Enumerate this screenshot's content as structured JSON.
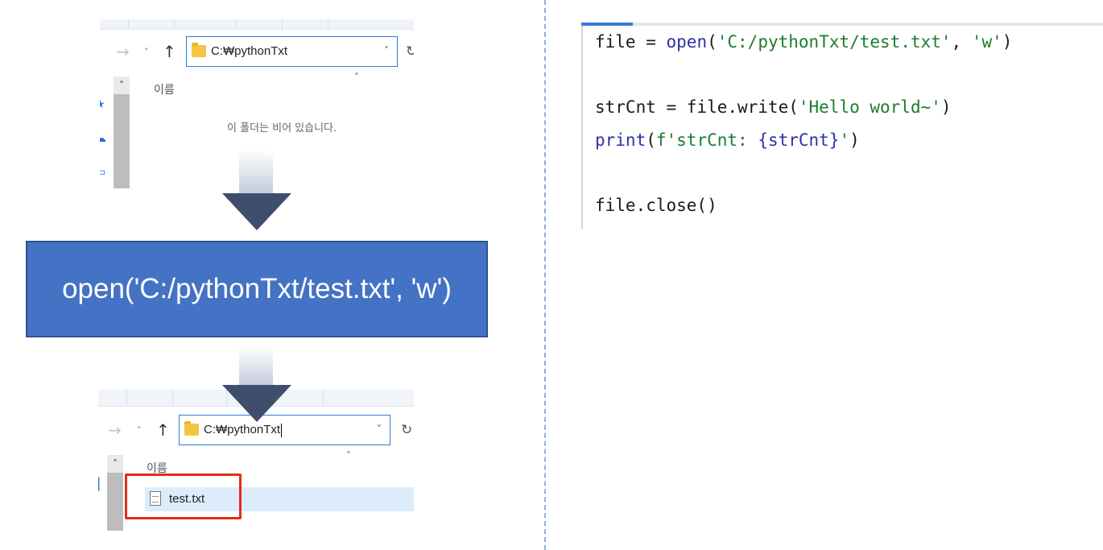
{
  "explorer_top": {
    "address_path": "C:₩pythonTxt",
    "column_name": "이름",
    "empty_message": "이 폴더는 비어 있습니다."
  },
  "explorer_bottom": {
    "address_path": "C:₩pythonTxt",
    "column_name": "이름",
    "file_name": "test.txt"
  },
  "open_box_text": "open('C:/pythonTxt/test.txt', 'w')",
  "icons": {
    "back": "→",
    "down": "˅",
    "up": "↑",
    "chevron": "˅",
    "refresh": "↻",
    "sort": "˄",
    "caret": "˄"
  },
  "code": {
    "line1": {
      "a": "file = ",
      "b": "open",
      "c": "(",
      "d": "'C:/pythonTxt/test.txt'",
      "e": ", ",
      "f": "'w'",
      "g": ")"
    },
    "line2": {
      "a": "strCnt = file.write(",
      "b": "'Hello world~'",
      "c": ")"
    },
    "line3": {
      "a": "print",
      "b": "(",
      "c": "f'strCnt: ",
      "d": "{strCnt}",
      "e": "'",
      "f": ")"
    },
    "line4": {
      "a": "file.close()"
    }
  },
  "colors": {
    "accent_blue": "#4472c4",
    "highlight_red": "#e12d1c",
    "string_green": "#1b7d2e"
  }
}
